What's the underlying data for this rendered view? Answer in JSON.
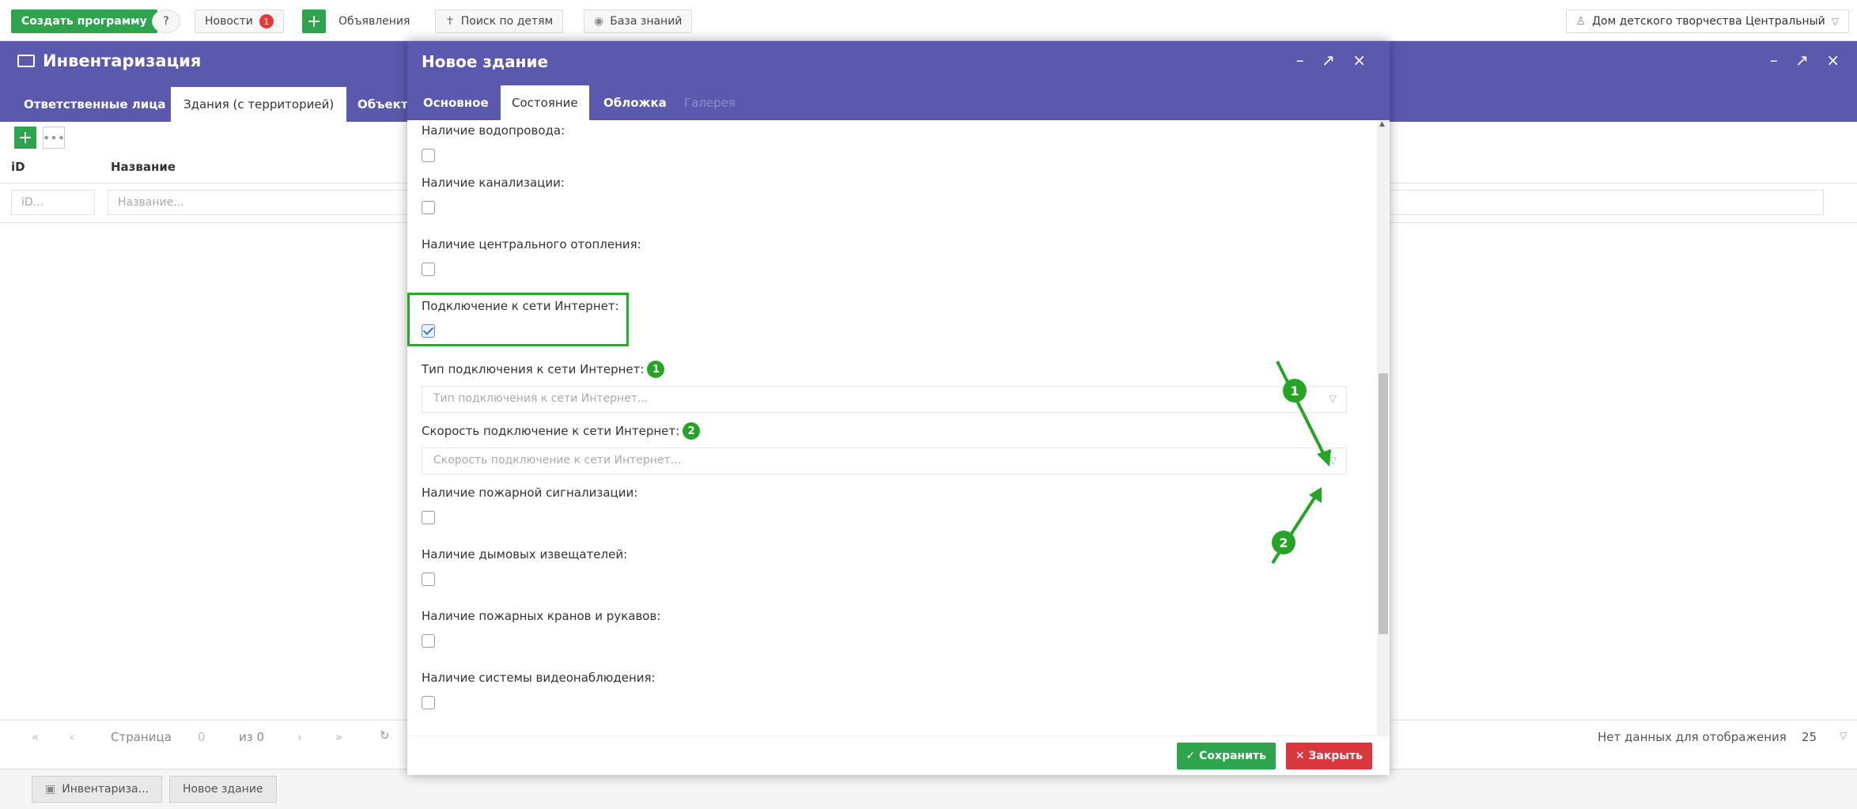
{
  "topbar": {
    "create_program": "Создать программу",
    "help": "?",
    "news": "Новости",
    "news_badge": "1",
    "plus": "+",
    "announcements": "Объявления",
    "search_children": "Поиск по детям",
    "knowledge_base": "База знаний",
    "org": "Дом детского творчества Центральный"
  },
  "window": {
    "title": "Инвентаризация",
    "controls": "– ↗ ×",
    "tabs": [
      "Ответственные лица",
      "Здания (с территорией)",
      "Объект"
    ],
    "active_tab": 1,
    "add": "+",
    "more": "•••",
    "columns": {
      "id": "iD",
      "name": "Название"
    },
    "filters": {
      "id": "iD...",
      "name": "Название..."
    },
    "pager": {
      "page_label": "Страница",
      "page": "0",
      "of": "из 0",
      "no_data": "Нет данных для отображения",
      "per_page": "25"
    }
  },
  "taskbar": {
    "items": [
      "Инвентариза...",
      "Новое здание"
    ]
  },
  "modal": {
    "title": "Новое здание",
    "controls": "– ↗ ×",
    "tabs": [
      "Основное",
      "Состояние",
      "Обложка",
      "Галерея"
    ],
    "active_tab": 1,
    "fields": {
      "water": "Наличие водопровода:",
      "sewer": "Наличие канализации:",
      "heating": "Наличие центрального отопления:",
      "internet": "Подключение к сети Интернет:",
      "conn_type": "Тип подключения к сети Интернет:",
      "conn_type_ph": "Тип подключения к сети Интернет...",
      "conn_speed": "Скорость подключение к сети Интернет:",
      "conn_speed_ph": "Скорость  подключение к сети Интернет...",
      "fire_alarm": "Наличие пожарной сигнализации:",
      "smoke": "Наличие дымовых извещателей:",
      "hydrants": "Наличие пожарных кранов и рукавов:",
      "video": "Наличие системы видеонаблюдения:"
    },
    "internet_checked": true,
    "markers": [
      "1",
      "2"
    ],
    "save": "✓ Сохранить",
    "close": "✕ Закрыть"
  },
  "colors": {
    "header": "#5b59ad",
    "green": "#2ea44f",
    "marker": "#25a525",
    "close": "#d9363e"
  }
}
